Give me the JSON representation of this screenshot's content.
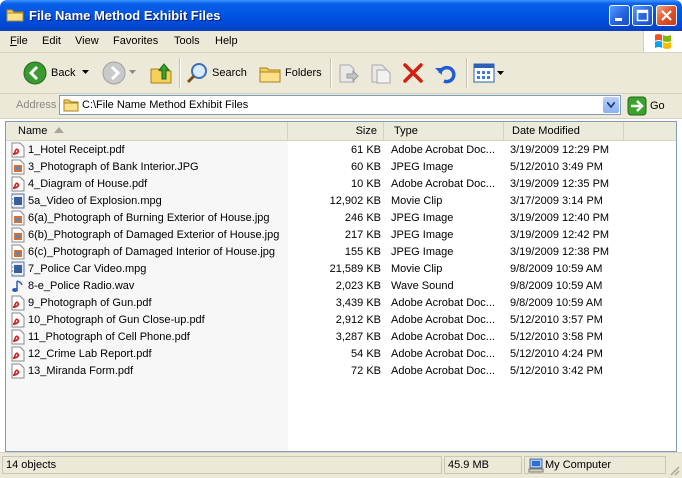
{
  "window": {
    "title": "File Name Method Exhibit Files"
  },
  "menu": [
    {
      "label": "File",
      "key": "F"
    },
    {
      "label": "Edit",
      "key": "E"
    },
    {
      "label": "View",
      "key": "V"
    },
    {
      "label": "Favorites",
      "key": "a"
    },
    {
      "label": "Tools",
      "key": "T"
    },
    {
      "label": "Help",
      "key": "H"
    }
  ],
  "toolbar": {
    "back_label": "Back",
    "search_label": "Search",
    "folders_label": "Folders"
  },
  "address": {
    "label": "Address",
    "path": "C:\\File Name Method Exhibit Files",
    "go_label": "Go"
  },
  "list": {
    "columns": [
      "Name",
      "Size",
      "Type",
      "Date Modified"
    ],
    "rows": [
      {
        "name": "1_Hotel Receipt.pdf",
        "size": "61 KB",
        "type": "Adobe Acrobat Doc...",
        "date": "3/19/2009 12:29 PM",
        "icon": "pdf-icon"
      },
      {
        "name": "3_Photograph of Bank Interior.JPG",
        "size": "60 KB",
        "type": "JPEG Image",
        "date": "5/12/2010 3:49 PM",
        "icon": "jpeg-icon"
      },
      {
        "name": "4_Diagram of House.pdf",
        "size": "10 KB",
        "type": "Adobe Acrobat Doc...",
        "date": "3/19/2009 12:35 PM",
        "icon": "pdf-icon"
      },
      {
        "name": "5a_Video of Explosion.mpg",
        "size": "12,902 KB",
        "type": "Movie Clip",
        "date": "3/17/2009 3:14 PM",
        "icon": "movie-icon"
      },
      {
        "name": "6(a)_Photograph of Burning Exterior of House.jpg",
        "size": "246 KB",
        "type": "JPEG Image",
        "date": "3/19/2009 12:40 PM",
        "icon": "jpeg-icon"
      },
      {
        "name": "6(b)_Photograph of Damaged Exterior of House.jpg",
        "size": "217 KB",
        "type": "JPEG Image",
        "date": "3/19/2009 12:42 PM",
        "icon": "jpeg-icon"
      },
      {
        "name": "6(c)_Photograph of Damaged Interior of House.jpg",
        "size": "155 KB",
        "type": "JPEG Image",
        "date": "3/19/2009 12:38 PM",
        "icon": "jpeg-icon"
      },
      {
        "name": "7_Police Car Video.mpg",
        "size": "21,589 KB",
        "type": "Movie Clip",
        "date": "9/8/2009 10:59 AM",
        "icon": "movie-icon"
      },
      {
        "name": "8-e_Police Radio.wav",
        "size": "2,023 KB",
        "type": "Wave Sound",
        "date": "9/8/2009 10:59 AM",
        "icon": "wave-icon"
      },
      {
        "name": "9_Photograph of Gun.pdf",
        "size": "3,439 KB",
        "type": "Adobe Acrobat Doc...",
        "date": "9/8/2009 10:59 AM",
        "icon": "pdf-icon"
      },
      {
        "name": "10_Photograph of Gun Close-up.pdf",
        "size": "2,912 KB",
        "type": "Adobe Acrobat Doc...",
        "date": "5/12/2010 3:57 PM",
        "icon": "pdf-icon"
      },
      {
        "name": "11_Photograph of Cell Phone.pdf",
        "size": "3,287 KB",
        "type": "Adobe Acrobat Doc...",
        "date": "5/12/2010 3:58 PM",
        "icon": "pdf-icon"
      },
      {
        "name": "12_Crime Lab Report.pdf",
        "size": "54 KB",
        "type": "Adobe Acrobat Doc...",
        "date": "5/12/2010 4:24 PM",
        "icon": "pdf-icon"
      },
      {
        "name": "13_Miranda Form.pdf",
        "size": "72 KB",
        "type": "Adobe Acrobat Doc...",
        "date": "5/12/2010 3:42 PM",
        "icon": "pdf-icon"
      }
    ]
  },
  "status": {
    "objects": "14 objects",
    "size": "45.9 MB",
    "location": "My Computer"
  },
  "colors": {
    "titlebar": "#0055e5",
    "chrome": "#ece9d8",
    "sorted_column": "#f7f7f7",
    "pdf_red": "#d21b1b"
  }
}
